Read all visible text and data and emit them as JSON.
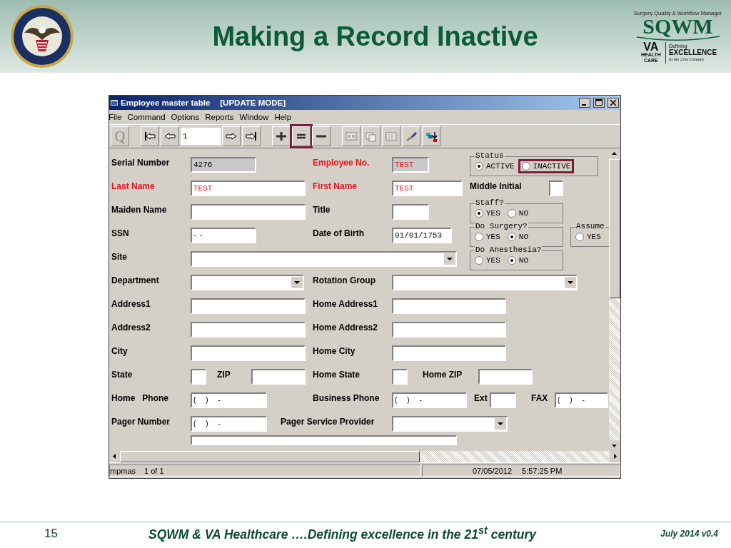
{
  "slide": {
    "title": "Making a Record Inactive",
    "logo": {
      "tagline": "Surgery Quality & Workflow Manager",
      "name": "SQWM",
      "va": "VA",
      "va_sub": "HEALTH CARE",
      "defining": "Defining",
      "excellence": "EXCELLENCE",
      "century": "in the 21st Century"
    },
    "footer": {
      "page": "15",
      "text": "SQWM & VA Healthcare ….Defining excellence in the 21$^{st}$ century",
      "version": "July 2014 v0.4"
    }
  },
  "window": {
    "title": "Employee master table",
    "mode": "[UPDATE MODE]",
    "menu": [
      "File",
      "Command",
      "Options",
      "Reports",
      "Window",
      "Help"
    ],
    "toolbar": [
      {
        "kind": "query",
        "text": "Q",
        "highlighted": false
      },
      {
        "kind": "first",
        "highlighted": false
      },
      {
        "kind": "prev",
        "highlighted": false
      },
      {
        "kind": "record",
        "text": "1",
        "highlighted": false
      },
      {
        "kind": "next",
        "highlighted": false
      },
      {
        "kind": "last",
        "highlighted": false
      },
      {
        "kind": "add",
        "highlighted": false
      },
      {
        "kind": "update",
        "highlighted": true
      },
      {
        "kind": "delete",
        "highlighted": false
      },
      {
        "kind": "form",
        "highlighted": false
      },
      {
        "kind": "copy",
        "highlighted": false
      },
      {
        "kind": "grid",
        "highlighted": false
      },
      {
        "kind": "brush",
        "highlighted": false
      },
      {
        "kind": "export",
        "highlighted": false
      }
    ],
    "rows": [
      [
        {
          "kind": "label",
          "text": "Serial Number",
          "required": false
        },
        {
          "kind": "field",
          "value": "4276",
          "readonly": true,
          "required": false
        },
        {
          "kind": "label",
          "text": "Employee No.",
          "required": true
        },
        {
          "kind": "field",
          "value": "TEST",
          "readonly": true,
          "required": true
        },
        {
          "kind": "group",
          "title": "Status",
          "options": [
            {
              "label": "ACTIVE",
              "selected": true,
              "highlighted": false
            },
            {
              "label": "INACTIVE",
              "selected": false,
              "highlighted": true
            }
          ]
        }
      ],
      [
        {
          "kind": "label",
          "text": "Last Name",
          "required": true
        },
        {
          "kind": "field",
          "value": "TEST",
          "readonly": false,
          "required": true
        },
        {
          "kind": "label",
          "text": "First Name",
          "required": true
        },
        {
          "kind": "field",
          "value": "TEST",
          "readonly": false,
          "required": true
        },
        {
          "kind": "label",
          "text": "Middle Initial",
          "required": false
        },
        {
          "kind": "field",
          "readonly": false
        }
      ],
      [
        {
          "kind": "label",
          "text": "Maiden Name",
          "required": false
        },
        {
          "kind": "field",
          "readonly": false
        },
        {
          "kind": "label",
          "text": "Title",
          "required": false
        },
        {
          "kind": "field",
          "readonly": false
        },
        {
          "kind": "group",
          "title": "Staff?",
          "options": [
            {
              "label": "YES",
              "selected": true,
              "highlighted": false
            },
            {
              "label": "NO",
              "selected": false,
              "highlighted": false
            }
          ]
        }
      ],
      [
        {
          "kind": "label",
          "text": "SSN",
          "required": false
        },
        {
          "kind": "phone",
          "value": "-  -",
          "readonly": false
        },
        {
          "kind": "label",
          "text": "Date of Birth",
          "required": false
        },
        {
          "kind": "field",
          "value": "01/01/1753",
          "readonly": false,
          "required": false
        },
        {
          "kind": "group",
          "title": "Do Surgery?",
          "options": [
            {
              "label": "YES",
              "selected": false,
              "highlighted": false
            },
            {
              "label": "NO",
              "selected": true,
              "highlighted": false
            }
          ]
        },
        {
          "kind": "group",
          "title": "Assume",
          "options": [
            {
              "label": "YES",
              "selected": false,
              "highlighted": false
            }
          ]
        }
      ],
      [
        {
          "kind": "label",
          "text": "Site",
          "required": false
        },
        {
          "kind": "dropdown"
        },
        "",
        "",
        {
          "kind": "group",
          "title": "Do Anesthesia?",
          "options": [
            {
              "label": "YES",
              "selected": false,
              "highlighted": false
            },
            {
              "label": "NO",
              "selected": true,
              "highlighted": false
            }
          ]
        }
      ],
      [
        {
          "kind": "label",
          "text": "Department",
          "required": false
        },
        {
          "kind": "dropdown"
        },
        {
          "kind": "label",
          "text": "Rotation Group",
          "required": false
        },
        {
          "kind": "dropdown"
        }
      ],
      [
        {
          "kind": "label",
          "text": "Address1",
          "required": false
        },
        {
          "kind": "field",
          "readonly": false
        },
        {
          "kind": "label",
          "text": "Home Address1",
          "required": false
        },
        {
          "kind": "field",
          "readonly": false
        }
      ],
      [
        {
          "kind": "label",
          "text": "Address2",
          "required": false
        },
        {
          "kind": "field",
          "readonly": false
        },
        {
          "kind": "label",
          "text": "Home Address2",
          "required": false
        },
        {
          "kind": "field",
          "readonly": false
        }
      ],
      [
        {
          "kind": "label",
          "text": "City",
          "required": false
        },
        {
          "kind": "field",
          "readonly": false
        },
        {
          "kind": "label",
          "text": "Home City",
          "required": false
        },
        {
          "kind": "field",
          "readonly": false
        }
      ],
      [
        {
          "kind": "label",
          "text": "State",
          "required": false
        },
        {
          "kind": "inline",
          "items": [
            {
              "kind": "field",
              "readonly": false
            },
            {
              "kind": "label",
              "text": "ZIP",
              "required": false
            },
            {
              "kind": "field",
              "readonly": false
            }
          ]
        },
        {
          "kind": "label",
          "text": "Home State",
          "required": false
        },
        {
          "kind": "inline",
          "items": [
            {
              "kind": "field",
              "readonly": false
            },
            {
              "kind": "label",
              "text": "Home ZIP",
              "required": false
            },
            {
              "kind": "field",
              "readonly": false
            }
          ]
        }
      ],
      [
        {
          "kind": "label",
          "text": "Home   Phone",
          "required": false
        },
        {
          "kind": "phone",
          "value": "(     )     -",
          "readonly": false
        },
        {
          "kind": "label",
          "text": "Business Phone",
          "required": false
        },
        {
          "kind": "inline",
          "items": [
            {
              "kind": "phone",
              "value": "(     )     -",
              "readonly": false
            },
            {
              "kind": "label",
              "text": "Ext",
              "required": false
            },
            {
              "kind": "field",
              "readonly": false
            },
            {
              "kind": "label",
              "text": "FAX",
              "required": false
            },
            {
              "kind": "phone",
              "value": "(     )     -",
              "readonly": false
            }
          ]
        }
      ],
      [
        {
          "kind": "label",
          "text": "Pager Number",
          "required": false
        },
        {
          "kind": "phone",
          "value": "(     )     -",
          "readonly": false
        },
        {
          "kind": "label",
          "text": "Pager Service Provider",
          "required": false
        },
        {
          "kind": "dropdown"
        }
      ]
    ],
    "status_bar": [
      "mpmas",
      "1 of 1",
      "07/05/2012",
      "5:57:25 PM"
    ]
  }
}
